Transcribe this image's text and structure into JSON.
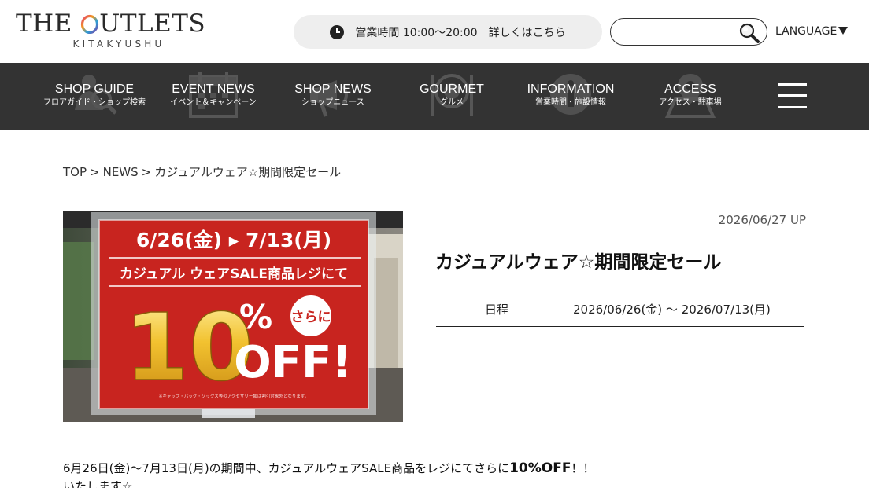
{
  "header": {
    "logo_main_before": "THE ",
    "logo_main_o": "O",
    "logo_main_after": "UTLETS",
    "logo_sub": "KITAKYUSHU",
    "hours_text": "営業時間 10:00〜20:00　詳しくはこちら",
    "search_placeholder": "",
    "language_label": "LANGUAGE"
  },
  "nav": {
    "items": [
      {
        "en": "SHOP GUIDE",
        "jp": "フロアガイド・ショップ検索",
        "icon": "search-person-icon"
      },
      {
        "en": "EVENT NEWS",
        "jp": "イベント＆キャンペーン",
        "icon": "calendar-icon"
      },
      {
        "en": "SHOP NEWS",
        "jp": "ショップニュース",
        "icon": "megaphone-icon"
      },
      {
        "en": "GOURMET",
        "jp": "グルメ",
        "icon": "cutlery-icon"
      },
      {
        "en": "INFORMATION",
        "jp": "営業時間・施設情報",
        "icon": "info-icon"
      },
      {
        "en": "ACCESS",
        "jp": "アクセス・駐車場",
        "icon": "map-pin-icon"
      }
    ],
    "menu_icon": "hamburger-menu-icon"
  },
  "breadcrumb": {
    "top": "TOP",
    "news": "NEWS",
    "current": "カジュアルウェア☆期間限定セール",
    "separator": ">"
  },
  "article": {
    "date": "2026/06/27 UP",
    "title": "カジュアルウェア☆期間限定セール",
    "schedule_label": "日程",
    "schedule_value": "2026/06/26(金) 〜 2026/07/13(月)",
    "body_line1_prefix": "6月26日(金)〜7月13日(月)の期間中、カジュアルウェアSALE商品をレジにてさらに",
    "body_line1_bold": "10%OFF",
    "body_line1_suffix": "！！",
    "body_line2": "いたします☆"
  },
  "poster": {
    "dates": "6/26(金) ▸ 7/13(月)",
    "headline": "カジュアル ウェアSALE商品レジにて",
    "badge": "さらに",
    "big_number": "10",
    "percent": "%",
    "off": "OFF!",
    "fine_print": "※キャップ・バッグ・ソックス等のアクセサリー類は割引対象外となります。"
  },
  "colors": {
    "nav_bg": "#333333",
    "pill_bg": "#eeeeee",
    "poster_red": "#c8241f",
    "poster_gold": "#f2c230"
  }
}
